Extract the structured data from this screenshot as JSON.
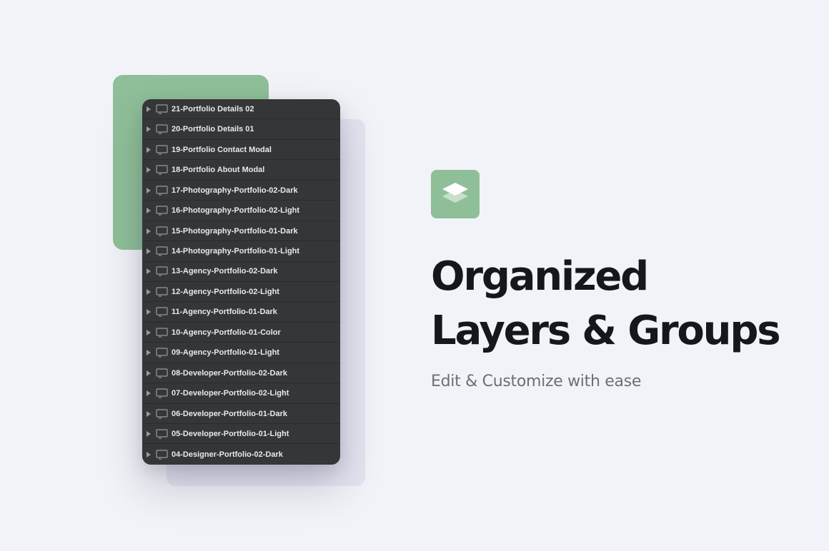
{
  "layers_panel": {
    "items": [
      {
        "label": "21-Portfolio Details 02"
      },
      {
        "label": "20-Portfolio Details 01"
      },
      {
        "label": "19-Portfolio Contact Modal"
      },
      {
        "label": "18-Portfolio About Modal"
      },
      {
        "label": "17-Photography-Portfolio-02-Dark"
      },
      {
        "label": "16-Photography-Portfolio-02-Light"
      },
      {
        "label": "15-Photography-Portfolio-01-Dark"
      },
      {
        "label": "14-Photography-Portfolio-01-Light"
      },
      {
        "label": "13-Agency-Portfolio-02-Dark"
      },
      {
        "label": "12-Agency-Portfolio-02-Light"
      },
      {
        "label": "11-Agency-Portfolio-01-Dark"
      },
      {
        "label": "10-Agency-Portfolio-01-Color"
      },
      {
        "label": "09-Agency-Portfolio-01-Light"
      },
      {
        "label": "08-Developer-Portfolio-02-Dark"
      },
      {
        "label": "07-Developer-Portfolio-02-Light"
      },
      {
        "label": "06-Developer-Portfolio-01-Dark"
      },
      {
        "label": "05-Developer-Portfolio-01-Light"
      },
      {
        "label": "04-Designer-Portfolio-02-Dark"
      }
    ],
    "expand_icon": "disclosure-triangle-icon",
    "item_icon": "artboard-icon"
  },
  "feature": {
    "icon": "layers-icon",
    "title_line1": "Organized",
    "title_line2": "Layers & Groups",
    "subtitle": "Edit & Customize with ease"
  },
  "colors": {
    "background": "#f2f3f8",
    "accent_green": "#8fbf98",
    "panel_dark": "#353638",
    "lavender": "#e4e4f1",
    "heading": "#15171c",
    "subtitle": "#6d6f76"
  }
}
